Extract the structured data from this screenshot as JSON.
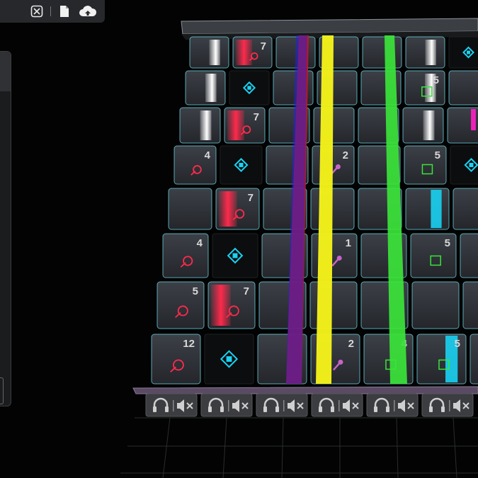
{
  "toolbar": {
    "icons": [
      "close-box-icon",
      "file-icon",
      "cloud-upload-icon"
    ]
  },
  "colors": {
    "background": "#030303",
    "pad": "#2f3238",
    "pad_edge": "#6fd8e6",
    "red": "#ff2a4c",
    "yellow": "#f4f21a",
    "green": "#3be43a",
    "blue": "#2222dd",
    "dark_red": "#c81818",
    "cyan": "#19d2f2",
    "white": "#f2f2f2",
    "magenta": "#ee22bb"
  },
  "pad_numbers": [
    "7",
    "5",
    "7",
    "4",
    "2",
    "5",
    "7",
    "4",
    "1",
    "5",
    "5",
    "7",
    "12",
    "2",
    "4",
    "5"
  ],
  "mixer": {
    "channel_icons": [
      "headphones-icon",
      "speaker-mute-icon"
    ],
    "channel_count": 6
  }
}
